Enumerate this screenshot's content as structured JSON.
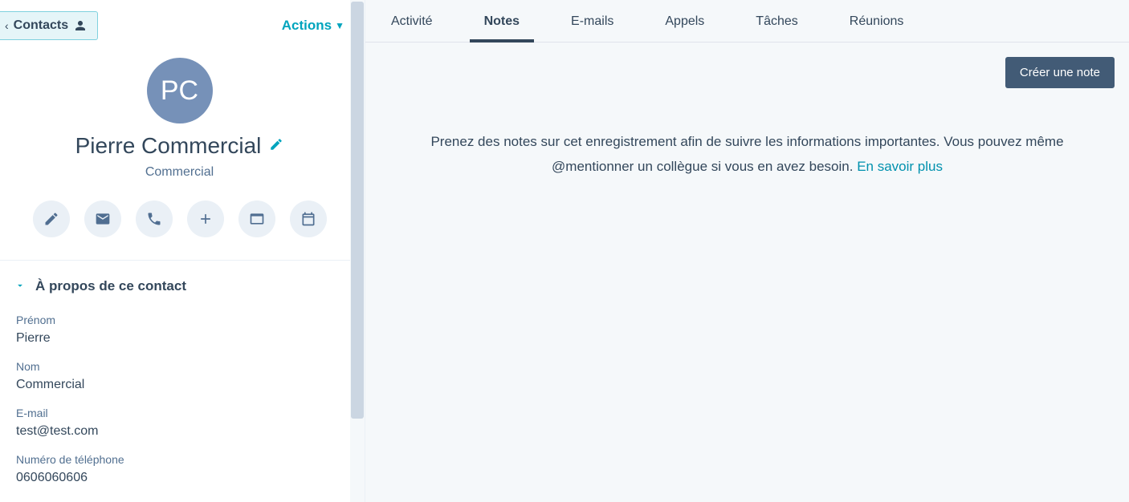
{
  "header": {
    "back_label": "Contacts",
    "actions_label": "Actions"
  },
  "contact": {
    "initials": "PC",
    "name": "Pierre Commercial",
    "role": "Commercial"
  },
  "actions": {
    "note": "note-icon",
    "email": "email-icon",
    "call": "phone-icon",
    "add": "plus-icon",
    "log": "window-icon",
    "schedule": "calendar-icon"
  },
  "about": {
    "section_title": "À propos de ce contact",
    "fields": {
      "first_name": {
        "label": "Prénom",
        "value": "Pierre"
      },
      "last_name": {
        "label": "Nom",
        "value": "Commercial"
      },
      "email": {
        "label": "E-mail",
        "value": "test@test.com"
      },
      "phone": {
        "label": "Numéro de téléphone",
        "value": "0606060606"
      }
    }
  },
  "tabs": {
    "activity": "Activité",
    "notes": "Notes",
    "emails": "E-mails",
    "calls": "Appels",
    "tasks": "Tâches",
    "meetings": "Réunions"
  },
  "notes": {
    "create_button": "Créer une note",
    "empty_text": "Prenez des notes sur cet enregistrement afin de suivre les informations importantes. Vous pouvez même @mentionner un collègue si vous en avez besoin. ",
    "learn_more": "En savoir plus"
  }
}
